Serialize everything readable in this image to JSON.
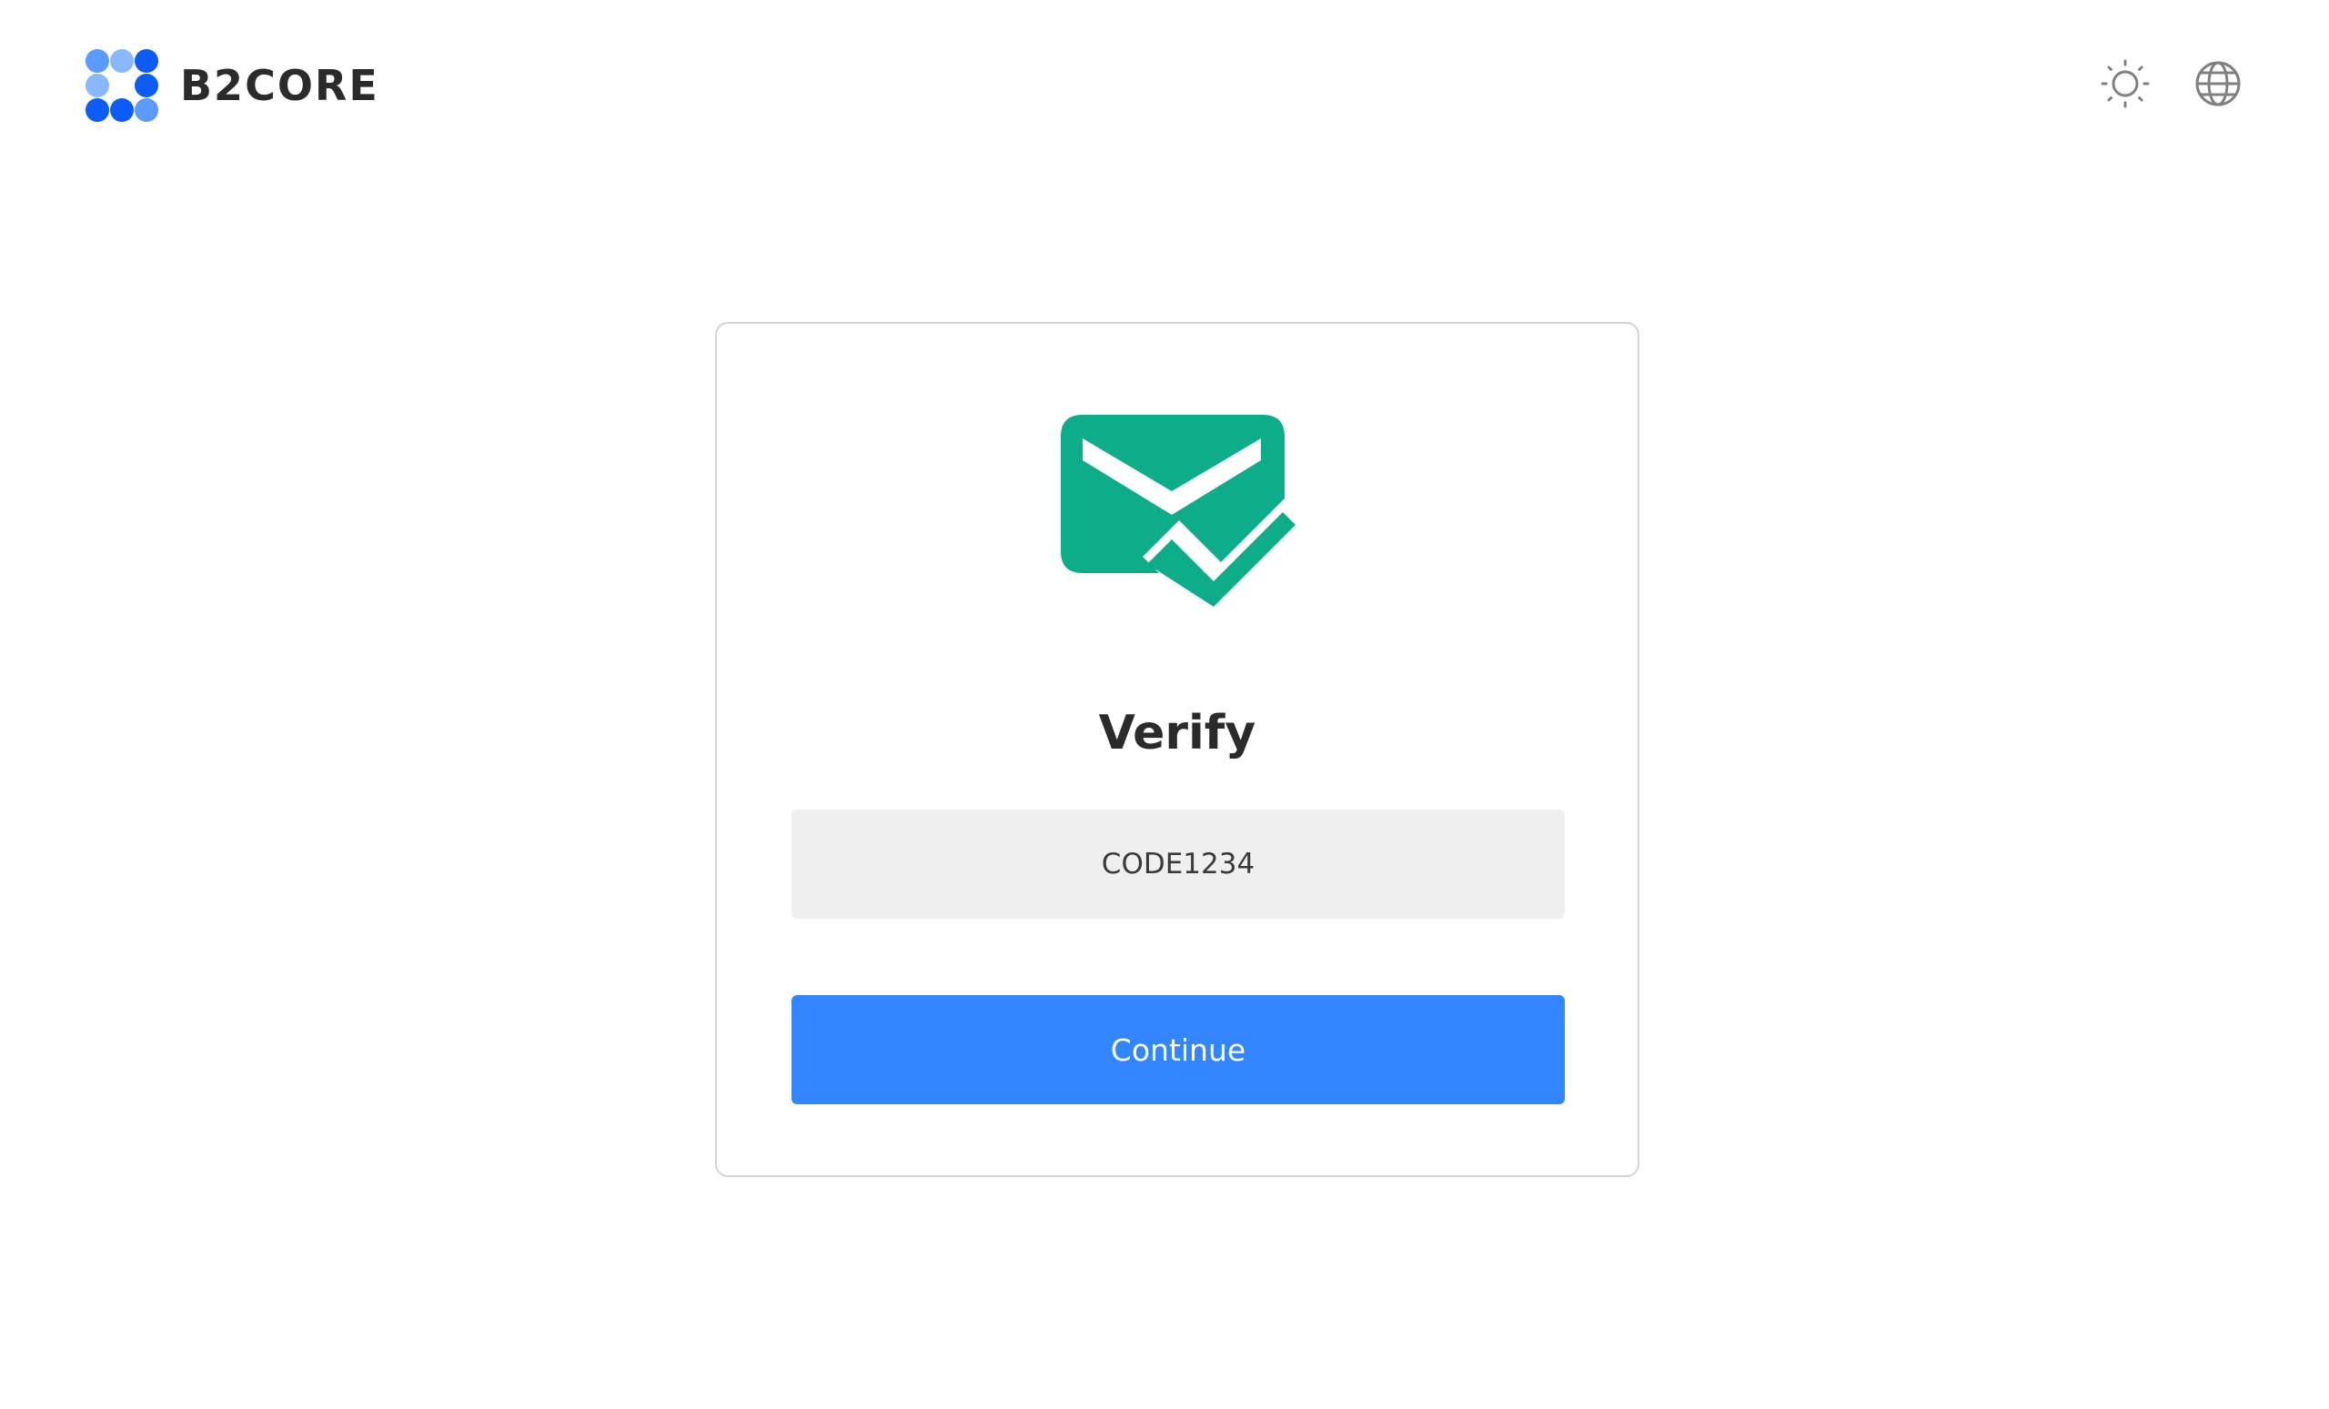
{
  "header": {
    "brand": "B2CORE",
    "logo_colors": [
      "#5b9bff",
      "#8ab8ff",
      "#0d5cf5"
    ],
    "theme_toggle_icon": "sun-icon",
    "language_icon": "globe-icon"
  },
  "card": {
    "hero_icon": "mail-check-icon",
    "hero_color": "#0ead8a",
    "title": "Verify",
    "code_input": {
      "value": "CODE1234"
    },
    "continue_label": "Continue",
    "accent_color": "#3386ff"
  }
}
